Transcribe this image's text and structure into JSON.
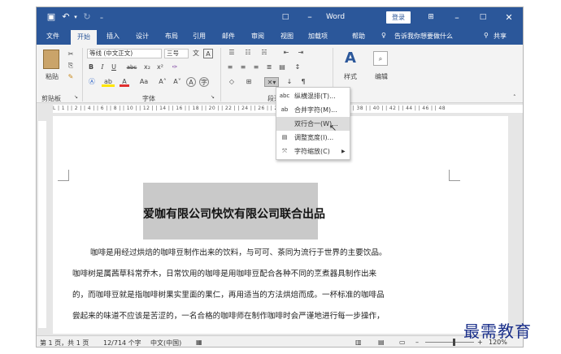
{
  "titlebar": {
    "app_title": "Word",
    "login": "登录"
  },
  "tabs": [
    "文件",
    "开始",
    "插入",
    "设计",
    "布局",
    "引用",
    "邮件",
    "审阅",
    "视图",
    "加载项",
    "帮助"
  ],
  "tellme": "告诉我你想要做什么",
  "share": "共享",
  "ribbon": {
    "clipboard": {
      "paste": "粘贴",
      "group": "剪贴板"
    },
    "font": {
      "font_name": "等线 (中文正文)",
      "font_size": "三号",
      "bold": "B",
      "italic": "I",
      "underline": "U",
      "strike": "abc",
      "sub": "x₂",
      "sup": "x²",
      "grow": "A˄",
      "shrink": "A˅",
      "color_a": "A",
      "aa": "Aa",
      "group": "字体"
    },
    "paragraph": {
      "group": "段落"
    },
    "styles": {
      "label": "样式"
    },
    "editing": {
      "label": "编辑"
    }
  },
  "ruler": "L  | 1 |  | 2 |  | 4 |  | 6 |  | 8 |  | 10 |  | 12 |  | 14 |  | 16 |  | 18 |  | 20 |  | 22 |  | 24 |  | 26 |  | 28 |  | 30 |  | 32 |  | 34 |  | 36 |  | 38 |  | 40 |  | 42 |  | 44 |  | 46 |  | 48",
  "document": {
    "title": "爱咖有限公司快饮有限公司联合出品",
    "paragraphs": [
      "咖啡是用经过烘焙的咖啡豆制作出来的饮料，与可可、茶同为流行于世界的主要饮品。",
      "咖啡树是属茜草科常乔木，日常饮用的咖啡是用咖啡豆配合各种不同的烹煮器具制作出来",
      "的，而咖啡豆就是指咖啡树果实里面的果仁，再用适当的方法烘焙而成。一杯标准的咖啡品",
      "尝起来的味道不应该是苦涩的，一名合格的咖啡师在制作咖啡时会严谨地进行每一步操作，"
    ]
  },
  "menu": {
    "items": [
      {
        "icon": "abc",
        "label": "纵横混排(T)..."
      },
      {
        "icon": "ab cd",
        "label": "合并字符(M)..."
      },
      {
        "icon": "",
        "label": "双行合一(W)..."
      },
      {
        "icon": "▤",
        "label": "调整宽度(I)..."
      },
      {
        "icon": "⤧",
        "label": "字符缩放(C)"
      }
    ]
  },
  "status": {
    "page": "第 1 页，共 1 页",
    "words": "12/714 个字",
    "lang": "中文(中国)",
    "zoom": "120%"
  },
  "watermark": "最需教育"
}
